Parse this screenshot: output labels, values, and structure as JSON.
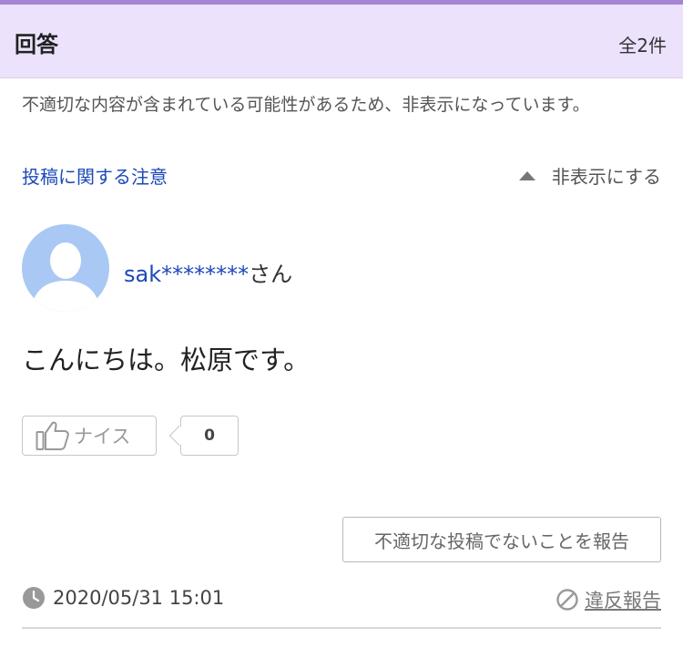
{
  "header": {
    "title": "回答",
    "count": "全2件"
  },
  "notice": {
    "message": "不適切な内容が含まれている可能性があるため、非表示になっています。",
    "guideline_link": "投稿に関する注意",
    "hide_label": "非表示にする"
  },
  "answer": {
    "user_id": "sak********",
    "user_suffix": "さん",
    "body": "こんにちは。松原です。",
    "nice_label": "ナイス",
    "nice_count": "0",
    "not_inappropriate_label": "不適切な投稿でないことを報告",
    "timestamp": "2020/05/31 15:01",
    "violation_label": "違反報告"
  },
  "colors": {
    "header_bg": "#ece2fb",
    "accent_purple": "#a585d6",
    "link_blue": "#1b49b8",
    "avatar_bg": "#a9c8f4"
  },
  "icons": {
    "avatar": "default-user-icon",
    "collapse": "triangle-up-icon",
    "nice": "thumbs-up-icon",
    "timestamp": "clock-icon",
    "violation": "ban-icon"
  }
}
